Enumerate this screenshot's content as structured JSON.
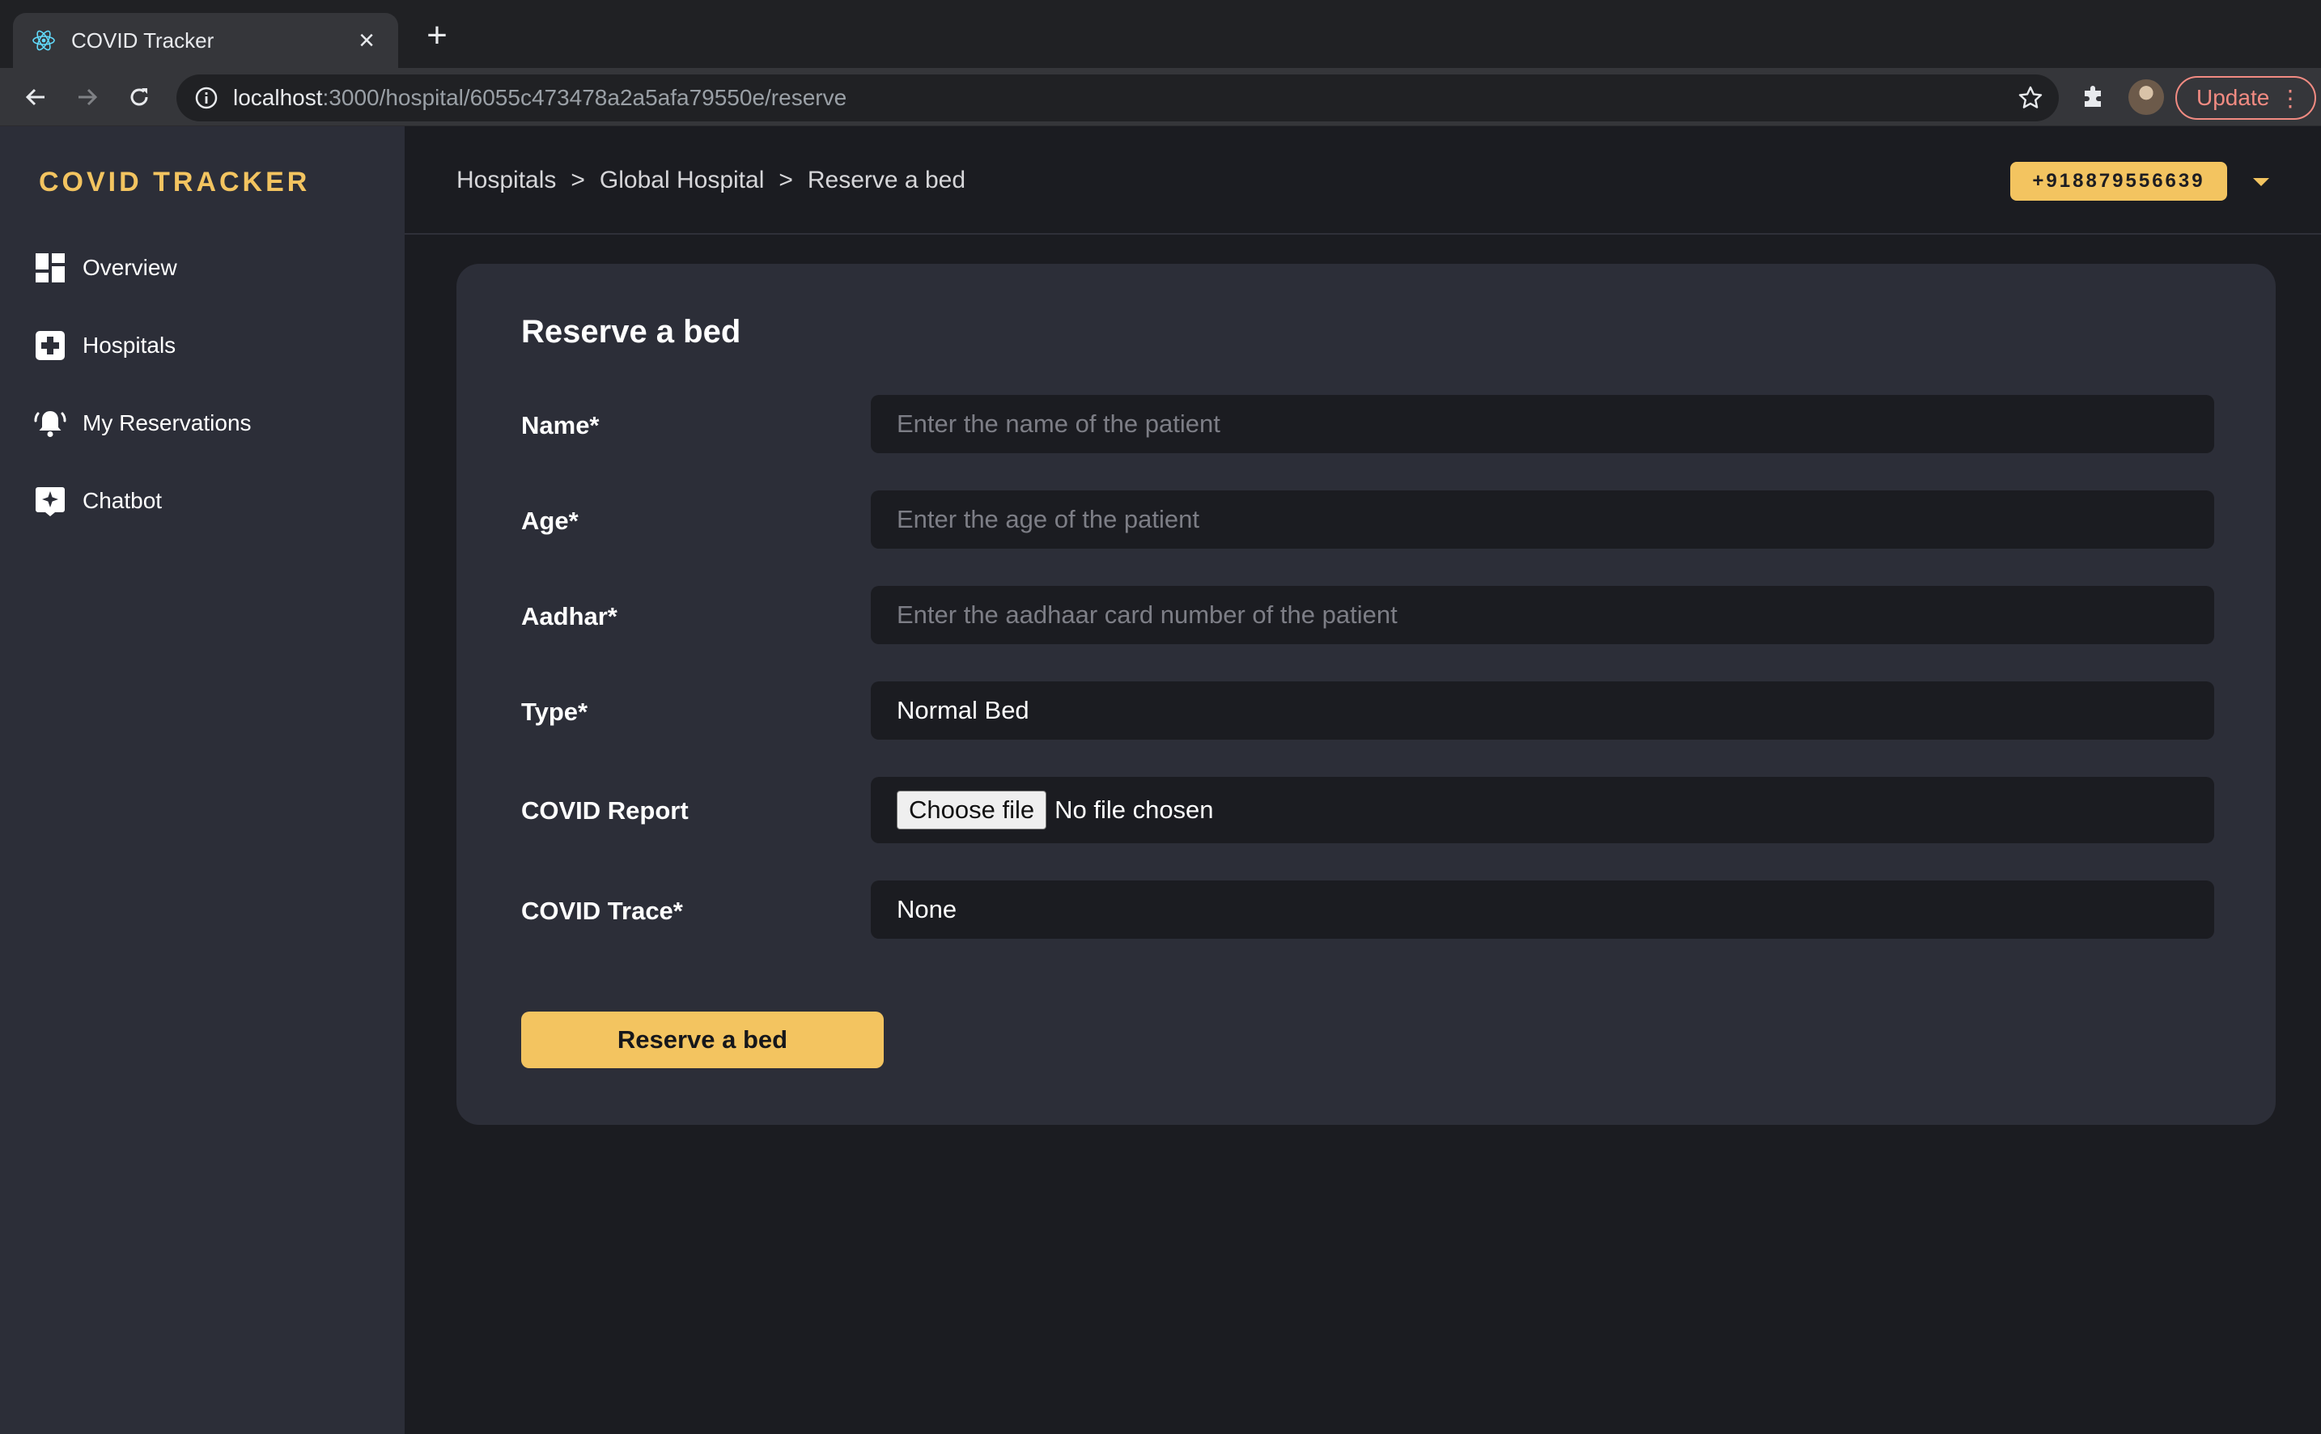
{
  "browser": {
    "tab_title": "COVID Tracker",
    "url_host": "localhost",
    "url_path": ":3000/hospital/6055c473478a2a5afa79550e/reserve",
    "update_label": "Update"
  },
  "sidebar": {
    "brand": "COVID TRACKER",
    "items": [
      {
        "label": "Overview",
        "icon": "dashboard-icon"
      },
      {
        "label": "Hospitals",
        "icon": "hospital-plus-icon"
      },
      {
        "label": "My Reservations",
        "icon": "bell-icon"
      },
      {
        "label": "Chatbot",
        "icon": "chatbot-sparkle-icon"
      }
    ]
  },
  "header": {
    "breadcrumb": [
      "Hospitals",
      "Global Hospital",
      "Reserve a bed"
    ],
    "separator": ">",
    "phone": "+918879556639"
  },
  "form": {
    "title": "Reserve a bed",
    "name": {
      "label": "Name*",
      "placeholder": "Enter the name of the patient",
      "value": ""
    },
    "age": {
      "label": "Age*",
      "placeholder": "Enter the age of the patient",
      "value": ""
    },
    "aadhar": {
      "label": "Aadhar*",
      "placeholder": "Enter the aadhaar card number of the patient",
      "value": ""
    },
    "type": {
      "label": "Type*",
      "value": "Normal Bed"
    },
    "report": {
      "label": "COVID Report",
      "button": "Choose file",
      "status": "No file chosen"
    },
    "trace": {
      "label": "COVID Trace*",
      "value": "None"
    },
    "submit": "Reserve a bed"
  },
  "colors": {
    "accent": "#f3c460",
    "sidebar_bg": "#2c2e38",
    "page_bg": "#1b1c21",
    "update_red": "#f28b82"
  }
}
